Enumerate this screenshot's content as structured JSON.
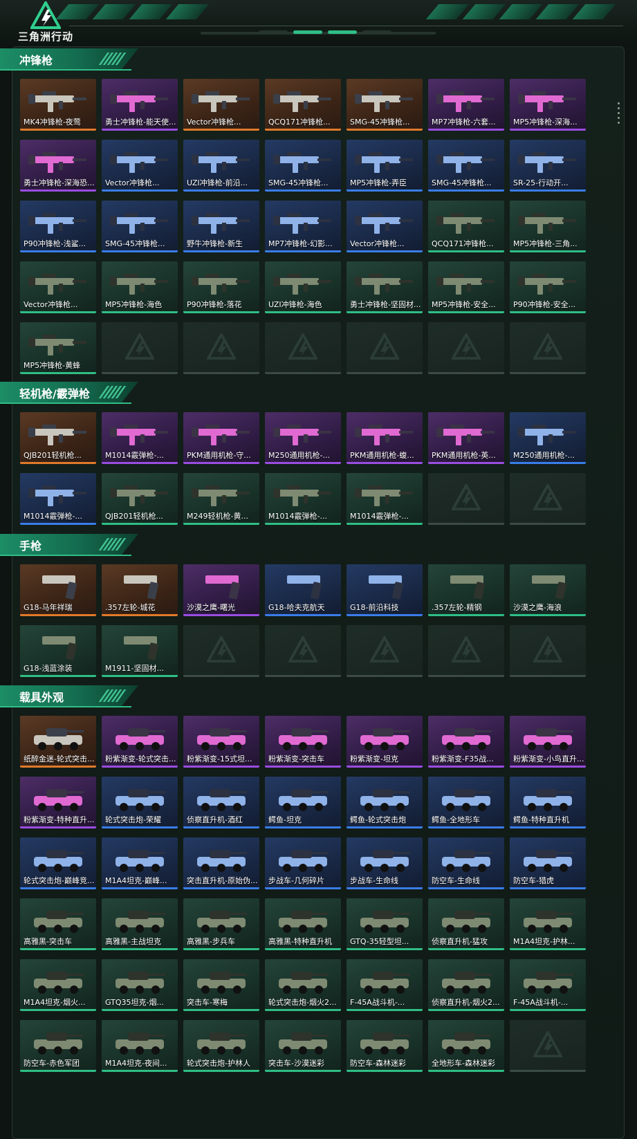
{
  "app": {
    "logo_text": "三角洲行动"
  },
  "colors": {
    "accent": "#2fbe86",
    "gold": "#e07a2b",
    "purple": "#9a4de0",
    "blue": "#3a7de8",
    "green": "#2fbe86"
  },
  "sections": [
    {
      "title": "冲锋枪",
      "kind": "gun",
      "items": [
        {
          "label": "MK4冲锋枪-夜莺",
          "rarity": "gold"
        },
        {
          "label": "勇士冲锋枪-能天使...",
          "rarity": "purple"
        },
        {
          "label": "Vector冲锋枪...",
          "rarity": "gold"
        },
        {
          "label": "QCQ171冲锋枪...",
          "rarity": "gold"
        },
        {
          "label": "SMG-45冲锋枪...",
          "rarity": "gold"
        },
        {
          "label": "MP7冲锋枪-六套...",
          "rarity": "purple"
        },
        {
          "label": "MP5冲锋枪-深海...",
          "rarity": "purple"
        },
        {
          "label": "勇士冲锋枪-深海恐...",
          "rarity": "purple"
        },
        {
          "label": "Vector冲锋枪...",
          "rarity": "blue"
        },
        {
          "label": "UZI冲锋枪-前沿...",
          "rarity": "blue"
        },
        {
          "label": "SMG-45冲锋枪...",
          "rarity": "blue"
        },
        {
          "label": "MP5冲锋枪-弄臣",
          "rarity": "blue"
        },
        {
          "label": "SMG-45冲锋枪...",
          "rarity": "blue"
        },
        {
          "label": "SR-25-行动开...",
          "rarity": "blue"
        },
        {
          "label": "P90冲锋枪-浅鲨...",
          "rarity": "blue"
        },
        {
          "label": "SMG-45冲锋枪...",
          "rarity": "blue"
        },
        {
          "label": "野牛冲锋枪-新生",
          "rarity": "blue"
        },
        {
          "label": "MP7冲锋枪-幻影...",
          "rarity": "blue"
        },
        {
          "label": "Vector冲锋枪...",
          "rarity": "blue"
        },
        {
          "label": "QCQ171冲锋枪...",
          "rarity": "green"
        },
        {
          "label": "MP5冲锋枪-三角...",
          "rarity": "green"
        },
        {
          "label": "Vector冲锋枪...",
          "rarity": "green"
        },
        {
          "label": "MP5冲锋枪-海色",
          "rarity": "green"
        },
        {
          "label": "P90冲锋枪-落花",
          "rarity": "green"
        },
        {
          "label": "UZI冲锋枪-海色",
          "rarity": "green"
        },
        {
          "label": "勇士冲锋枪-坚固材...",
          "rarity": "green"
        },
        {
          "label": "MP5冲锋枪-安全...",
          "rarity": "green"
        },
        {
          "label": "P90冲锋枪-安全...",
          "rarity": "green"
        },
        {
          "label": "MP5冲锋枪-黄蜂",
          "rarity": "green"
        },
        {
          "label": "",
          "rarity": "empty"
        },
        {
          "label": "",
          "rarity": "empty"
        },
        {
          "label": "",
          "rarity": "empty"
        },
        {
          "label": "",
          "rarity": "empty"
        },
        {
          "label": "",
          "rarity": "empty"
        },
        {
          "label": "",
          "rarity": "empty"
        }
      ]
    },
    {
      "title": "轻机枪/霰弹枪",
      "kind": "gun",
      "items": [
        {
          "label": "QJB201轻机枪...",
          "rarity": "gold"
        },
        {
          "label": "M1014霰弹枪-...",
          "rarity": "purple"
        },
        {
          "label": "PKM通用机枪-守...",
          "rarity": "purple"
        },
        {
          "label": "M250通用机枪-...",
          "rarity": "purple"
        },
        {
          "label": "PKM通用机枪-蝮...",
          "rarity": "purple"
        },
        {
          "label": "PKM通用机枪-英...",
          "rarity": "purple"
        },
        {
          "label": "M250通用机枪-...",
          "rarity": "blue"
        },
        {
          "label": "M1014霰弹枪-...",
          "rarity": "blue"
        },
        {
          "label": "QJB201轻机枪...",
          "rarity": "green"
        },
        {
          "label": "M249轻机枪-黄...",
          "rarity": "green"
        },
        {
          "label": "M1014霰弹枪-...",
          "rarity": "green"
        },
        {
          "label": "M1014霰弹枪-...",
          "rarity": "green"
        },
        {
          "label": "",
          "rarity": "empty"
        },
        {
          "label": "",
          "rarity": "empty"
        }
      ]
    },
    {
      "title": "手枪",
      "kind": "pistol",
      "items": [
        {
          "label": "G18-马年祥瑞",
          "rarity": "gold"
        },
        {
          "label": ".357左轮-城花",
          "rarity": "gold"
        },
        {
          "label": "沙漠之鹰-曙光",
          "rarity": "purple"
        },
        {
          "label": "G18-哈夫克航天",
          "rarity": "blue"
        },
        {
          "label": "G18-前沿科技",
          "rarity": "blue"
        },
        {
          "label": ".357左轮-精钢",
          "rarity": "green"
        },
        {
          "label": "沙漠之鹰-海浪",
          "rarity": "green"
        },
        {
          "label": "G18-浅蓝涂装",
          "rarity": "green"
        },
        {
          "label": "M1911-坚固材...",
          "rarity": "green"
        },
        {
          "label": "",
          "rarity": "empty"
        },
        {
          "label": "",
          "rarity": "empty"
        },
        {
          "label": "",
          "rarity": "empty"
        },
        {
          "label": "",
          "rarity": "empty"
        },
        {
          "label": "",
          "rarity": "empty"
        }
      ]
    },
    {
      "title": "载具外观",
      "kind": "vehicle",
      "items": [
        {
          "label": "纸醉金迷-轮式突击...",
          "rarity": "gold"
        },
        {
          "label": "粉紫渐变-轮式突击...",
          "rarity": "purple"
        },
        {
          "label": "粉紫渐变-15式坦...",
          "rarity": "purple"
        },
        {
          "label": "粉紫渐变-突击车",
          "rarity": "purple"
        },
        {
          "label": "粉紫渐变-坦克",
          "rarity": "purple"
        },
        {
          "label": "粉紫渐变-F35战...",
          "rarity": "purple"
        },
        {
          "label": "粉紫渐变-小鸟直升...",
          "rarity": "purple"
        },
        {
          "label": "粉紫渐变-特种直升...",
          "rarity": "purple"
        },
        {
          "label": "轮式突击炮-荣耀",
          "rarity": "blue"
        },
        {
          "label": "侦察直升机-酒红",
          "rarity": "blue"
        },
        {
          "label": "鳄鱼-坦克",
          "rarity": "blue"
        },
        {
          "label": "鳄鱼-轮式突击炮",
          "rarity": "blue"
        },
        {
          "label": "鳄鱼-全地形车",
          "rarity": "blue"
        },
        {
          "label": "鳄鱼-特种直升机",
          "rarity": "blue"
        },
        {
          "label": "轮式突击炮-巅峰竞...",
          "rarity": "blue"
        },
        {
          "label": "M1A4坦克-巅峰...",
          "rarity": "blue"
        },
        {
          "label": "突击直升机-原始伪...",
          "rarity": "blue"
        },
        {
          "label": "步战车-几何碎片",
          "rarity": "blue"
        },
        {
          "label": "步战车-生命线",
          "rarity": "blue"
        },
        {
          "label": "防空车-生命线",
          "rarity": "blue"
        },
        {
          "label": "防空车-猎虎",
          "rarity": "blue"
        },
        {
          "label": "高雅黑-突击车",
          "rarity": "green"
        },
        {
          "label": "高雅黑-主战坦克",
          "rarity": "green"
        },
        {
          "label": "高雅黑-步兵车",
          "rarity": "green"
        },
        {
          "label": "高雅黑-特种直升机",
          "rarity": "green"
        },
        {
          "label": "GTQ-35轻型坦...",
          "rarity": "green"
        },
        {
          "label": "侦察直升机-猛攻",
          "rarity": "green"
        },
        {
          "label": "M1A4坦克-护林...",
          "rarity": "green"
        },
        {
          "label": "M1A4坦克-烟火...",
          "rarity": "green"
        },
        {
          "label": "GTQ35坦克-烟...",
          "rarity": "green"
        },
        {
          "label": "突击车-寒梅",
          "rarity": "green"
        },
        {
          "label": "轮式突击炮-烟火2...",
          "rarity": "green"
        },
        {
          "label": "F-45A战斗机-...",
          "rarity": "green"
        },
        {
          "label": "侦察直升机-烟火2...",
          "rarity": "green"
        },
        {
          "label": "F-45A战斗机-...",
          "rarity": "green"
        },
        {
          "label": "防空车-赤色军团",
          "rarity": "green"
        },
        {
          "label": "M1A4坦克-夜间...",
          "rarity": "green"
        },
        {
          "label": "轮式突击炮-护林人",
          "rarity": "green"
        },
        {
          "label": "突击车-沙漠迷彩",
          "rarity": "green"
        },
        {
          "label": "防空车-森林迷彩",
          "rarity": "green"
        },
        {
          "label": "全地形车-森林迷彩",
          "rarity": "green"
        },
        {
          "label": "",
          "rarity": "empty"
        }
      ]
    }
  ]
}
